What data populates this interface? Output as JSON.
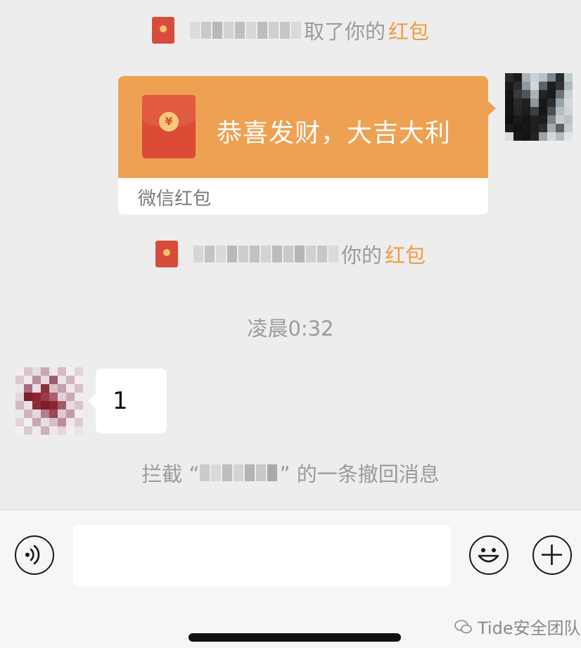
{
  "system_messages": [
    {
      "text": "取了你的",
      "link": "红包"
    },
    {
      "text": "你的",
      "link": "红包"
    }
  ],
  "red_packet": {
    "greeting": "恭喜发财，大吉大利",
    "label": "微信红包",
    "coin_symbol": "¥"
  },
  "timestamp": "凌晨0:32",
  "incoming_message": {
    "text": "1"
  },
  "recall_notice": {
    "prefix": "拦截 “",
    "suffix": "” 的一条撤回消息"
  },
  "input_bar": {
    "placeholder": ""
  },
  "watermark": "Tide安全团队",
  "colors": {
    "background": "#ededed",
    "red_packet_orange": "#eea152",
    "red_packet_red": "#db4b35",
    "link_orange": "#f39a40",
    "system_text": "#9b9b9b"
  },
  "icons": [
    "red-packet-icon",
    "voice-icon",
    "emoji-icon",
    "plus-icon"
  ]
}
